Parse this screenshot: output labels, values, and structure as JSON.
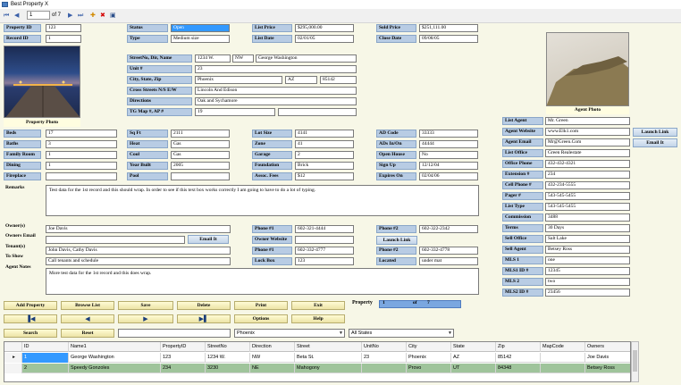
{
  "window": {
    "title": "Best Property X"
  },
  "toolbar": {
    "record": "1",
    "of_label": "of 7"
  },
  "photos": {
    "property": "Property Photo",
    "agent": "Agent Photo"
  },
  "labels": {
    "property_id": "Property ID",
    "record_id": "Record ID",
    "status": "Status",
    "type": "Type",
    "list_price": "List Price",
    "list_date": "List Date",
    "sold_price": "Sold Price",
    "close_date": "Close Date",
    "street": "StreetNo, Dir, Name",
    "unit": "Unit #",
    "city_state_zip": "City, State, Zip",
    "cross_streets": "Cross Streets N/S E/W",
    "directions": "Directions",
    "tg_map": "TG Map #, AP #",
    "beds": "Beds",
    "baths": "Baths",
    "family_room": "Family Room",
    "dining": "Dining",
    "fireplace": "Fireplace",
    "sq_ft": "Sq Ft",
    "heat": "Heat",
    "cool": "Cool",
    "year_built": "Year Built",
    "pool": "Pool",
    "lot_size": "Lot Size",
    "zone": "Zone",
    "garage": "Garage",
    "foundation": "Foundation",
    "assoc_fees": "Assoc. Fees",
    "ad_code": "AD Code",
    "ads_in_on": "ADs In/On",
    "open_house": "Open House",
    "sign_up": "Sign Up",
    "expires_on": "Expires On",
    "remarks": "Remarks",
    "owners": "Owner(s)",
    "owners_email": "Owners Email",
    "tenants": "Tenant(s)",
    "to_show": "To Show",
    "agent_notes": "Agent Notes",
    "phone1": "Phone #1",
    "owner_website": "Owner Website",
    "phone2": "Phone #2",
    "phone1b": "Phone #1",
    "phone2b": "Phone #2",
    "lock_box": "Lock Box",
    "located": "Located",
    "list_agent": "List Agent",
    "agent_website": "Agent Website",
    "agent_email": "Agent Email",
    "list_office": "List Office",
    "office_phone": "Office Phone",
    "extension": "Extension #",
    "cell_phone": "Cell Phone #",
    "pager": "Pager #",
    "list_type": "List Type",
    "commission": "Commission",
    "terms": "Terms",
    "sell_office": "Sell Office",
    "sell_agent": "Sell Agent",
    "mls1": "MLS 1",
    "mls1_id": "MLS1 ID #",
    "mls2": "MLS 2",
    "mls2_id": "MLS2 ID #",
    "property": "Property",
    "of": "of"
  },
  "values": {
    "property_id": "123",
    "record_id": "1",
    "status": "Open",
    "type": "Medium size",
    "list_price": "$295,000.00",
    "list_date": "02/01/05",
    "sold_price": "$251,111.00",
    "close_date": "09/08/05",
    "street_no": "1234 W.",
    "street_dir": "NW",
    "street_name": "George Washington",
    "unit": "23",
    "city": "Phoenix",
    "state": "AZ",
    "zip": "85142",
    "cross_streets": "Lincoln And Edison",
    "directions": "Oak and Sychamore",
    "tg_map": "19",
    "beds": "17",
    "baths": "3",
    "family_room": "1",
    "dining": "1",
    "sq_ft": "2111",
    "heat": "Gas",
    "cool": "Gas",
    "year_built": "2005",
    "lot_size": "4141",
    "zone": "41",
    "garage": "2",
    "foundation": "Brick",
    "assoc_fees": "$12",
    "ad_code": "33333",
    "ads_in_on": "44444",
    "open_house": "No",
    "sign_up": "12/12/04",
    "expires_on": "02/04/06",
    "remarks": "Test data for the 1st record and this should wrap.  In order to see if this text box works correctly I am going to have to do a lot of typing.",
    "owners": "Joe Davis",
    "tenants": "John Davis, Cathy Davis",
    "to_show": "Call tenants and schedule",
    "agent_notes": "More test data for the 1st record and this does wrap.",
    "phone1": "602-321-4444",
    "phone2": "602-322-2342",
    "phone1b": "602-332-4777",
    "phone2b": "602-332-4778",
    "lock_box": "123",
    "located": "under mat",
    "list_agent": "Mr. Green",
    "agent_website": "www.Elk1.com",
    "agent_email": "Mr@Green.Com",
    "list_office": "Green Realestate",
    "office_phone": "432-432-4321",
    "extension": "234",
    "cell_phone": "432-234-5555",
    "pager": "543-545-5455",
    "list_type": "543-545-5455",
    "commission": "3488",
    "terms": "30 Days",
    "sell_office": "Salt Lake",
    "sell_agent": "Betsey Ross",
    "mls1": "one",
    "mls1_id": "12345",
    "mls2": "two",
    "mls2_id": "23456",
    "position": "1",
    "total": "7"
  },
  "buttons": {
    "email_it": "Email It",
    "launch_link": "Launch Link",
    "launch_link2": "Launch Link",
    "email_it2": "Email It",
    "add_property": "Add Property",
    "browse_list": "Browse List",
    "save": "Save",
    "delete": "Delete",
    "print": "Print",
    "exit": "Exit",
    "options": "Options",
    "help": "Help",
    "search": "Search",
    "reset": "Reset"
  },
  "filters": {
    "city": "Phoenix",
    "state": "All States"
  },
  "grid": {
    "columns": [
      "ID",
      "Name1",
      "PropertyID",
      "StreetNo",
      "Direction",
      "Street",
      "UnitNo",
      "City",
      "State",
      "Zip",
      "MapCode",
      "Owners"
    ],
    "rows": [
      [
        "1",
        "George Washington",
        "123",
        "1234 W.",
        "NW",
        "Beta St.",
        "23",
        "Phoenix",
        "AZ",
        "85142",
        "",
        "Joe Davis"
      ],
      [
        "2",
        "Speedy Gonzoles",
        "234",
        "3230",
        "NE",
        "Mahogony",
        "",
        "Provo",
        "UT",
        "84348",
        "",
        "Betsey Ross"
      ]
    ]
  }
}
